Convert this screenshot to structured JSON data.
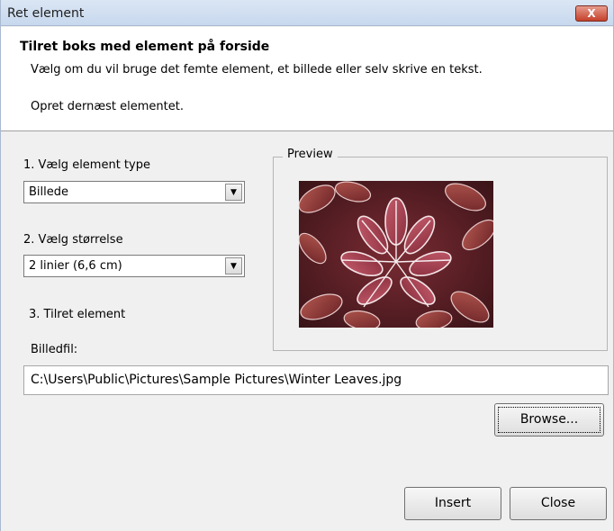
{
  "window": {
    "title": "Ret element",
    "close_glyph": "X"
  },
  "header": {
    "title": "Tilret boks med element på forside",
    "line1": "Vælg om du vil bruge det femte element, et billede eller selv skrive en tekst.",
    "line2": "Opret dernæst elementet."
  },
  "step1": {
    "label": "1. Vælg element type",
    "selected": "Billede"
  },
  "step2": {
    "label": "2. Vælg størrelse",
    "selected": "2 linier (6,6 cm)"
  },
  "step3": {
    "label": "3. Tilret element"
  },
  "file": {
    "label": "Billedfil:",
    "value": "C:\\Users\\Public\\Pictures\\Sample Pictures\\Winter Leaves.jpg"
  },
  "preview": {
    "legend": "Preview",
    "image_icon": "winter-leaves-photo"
  },
  "buttons": {
    "browse": "Browse...",
    "insert": "Insert",
    "close": "Close"
  },
  "colors": {
    "titlebar": "#c7d8ee",
    "close_button": "#c4412b",
    "dialog_bg": "#f0f0f0"
  }
}
